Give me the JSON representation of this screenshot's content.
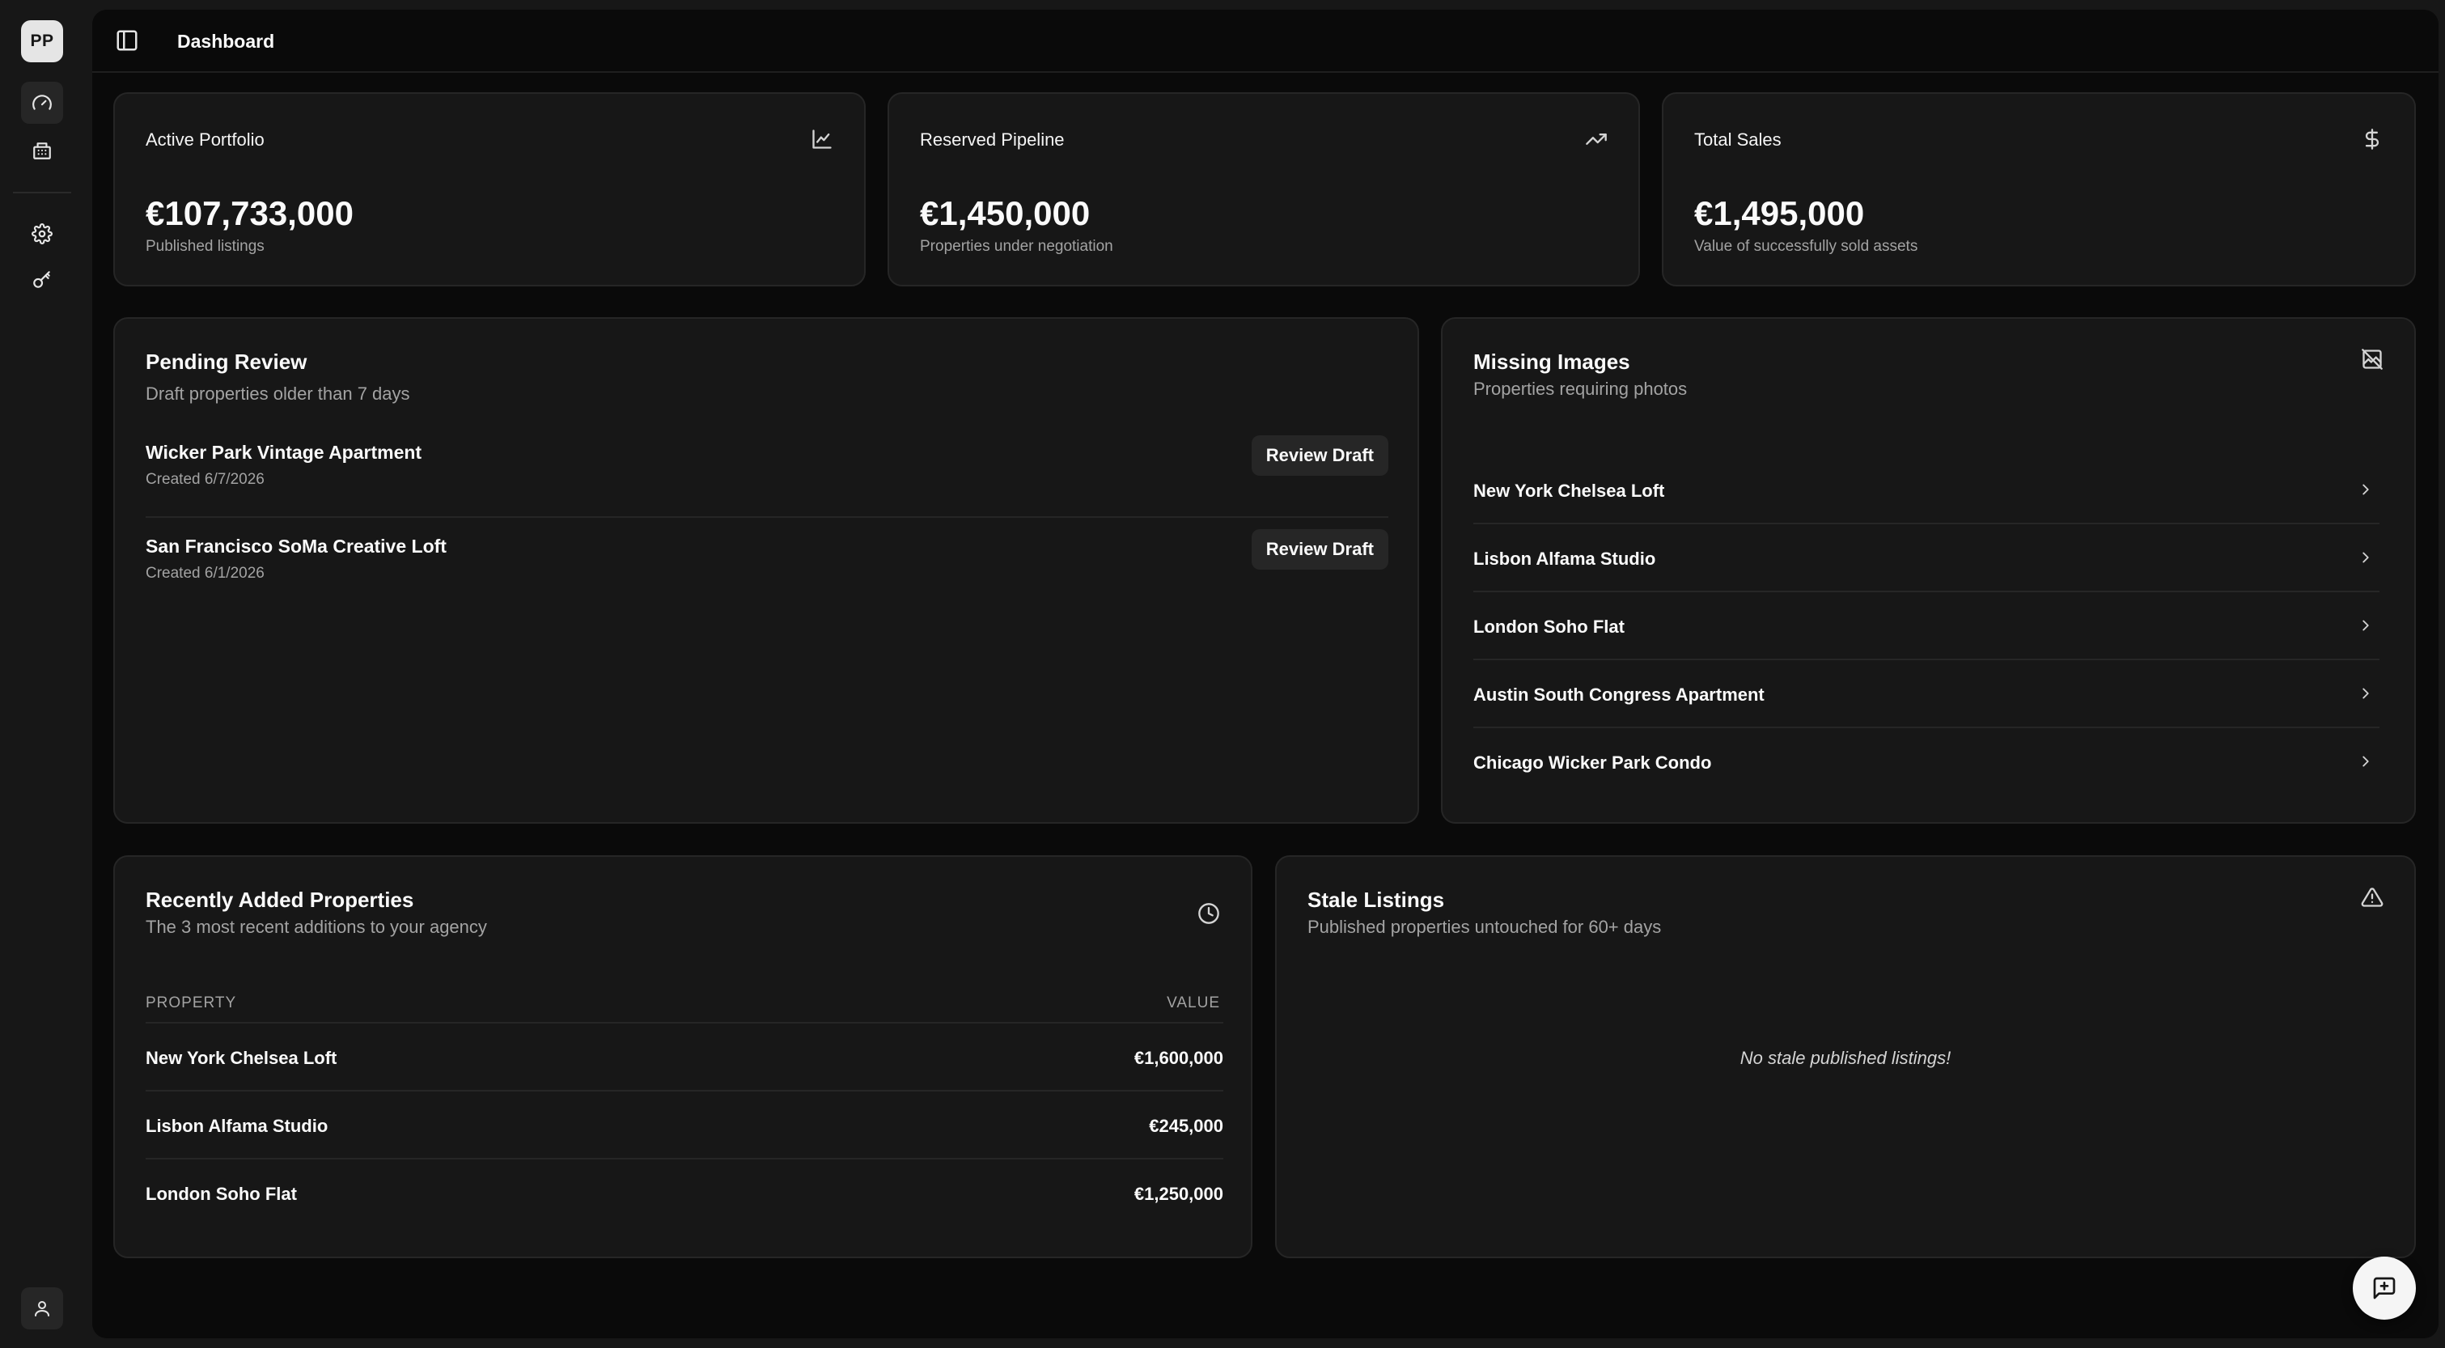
{
  "sidebar": {
    "avatar_initials": "PP",
    "nav": [
      {
        "icon": "gauge-icon",
        "active": true
      },
      {
        "icon": "building-icon",
        "active": false
      },
      {
        "icon": "gear-icon",
        "active": false
      },
      {
        "icon": "key-icon",
        "active": false
      }
    ],
    "user_icon": "user-icon"
  },
  "header": {
    "title": "Dashboard",
    "toggle_icon": "sidebar-toggle-icon"
  },
  "stats": [
    {
      "label": "Active Portfolio",
      "value": "€107,733,000",
      "sub": "Published listings",
      "icon": "line-chart-icon"
    },
    {
      "label": "Reserved Pipeline",
      "value": "€1,450,000",
      "sub": "Properties under negotiation",
      "icon": "trending-up-icon"
    },
    {
      "label": "Total Sales",
      "value": "€1,495,000",
      "sub": "Value of successfully sold assets",
      "icon": "dollar-icon"
    }
  ],
  "pending_review": {
    "title": "Pending Review",
    "description": "Draft properties older than 7 days",
    "items": [
      {
        "name": "Wicker Park Vintage Apartment",
        "created": "Created 6/7/2026",
        "action": "Review Draft"
      },
      {
        "name": "San Francisco SoMa Creative Loft",
        "created": "Created 6/1/2026",
        "action": "Review Draft"
      }
    ]
  },
  "missing_images": {
    "title": "Missing Images",
    "description": "Properties requiring photos",
    "icon": "image-off-icon",
    "items": [
      {
        "name": "New York Chelsea Loft"
      },
      {
        "name": "Lisbon Alfama Studio"
      },
      {
        "name": "London Soho Flat"
      },
      {
        "name": "Austin South Congress Apartment"
      },
      {
        "name": "Chicago Wicker Park Condo"
      }
    ]
  },
  "recent": {
    "title": "Recently Added Properties",
    "description": "The 3 most recent additions to your agency",
    "icon": "clock-icon",
    "columns": [
      "PROPERTY",
      "VALUE"
    ],
    "rows": [
      {
        "property": "New York Chelsea Loft",
        "value": "€1,600,000"
      },
      {
        "property": "Lisbon Alfama Studio",
        "value": "€245,000"
      },
      {
        "property": "London Soho Flat",
        "value": "€1,250,000"
      }
    ]
  },
  "stale": {
    "title": "Stale Listings",
    "description": "Published properties untouched for 60+ days",
    "icon": "alert-triangle-icon",
    "empty_message": "No stale published listings!"
  },
  "fab": {
    "icon": "message-plus-icon"
  }
}
